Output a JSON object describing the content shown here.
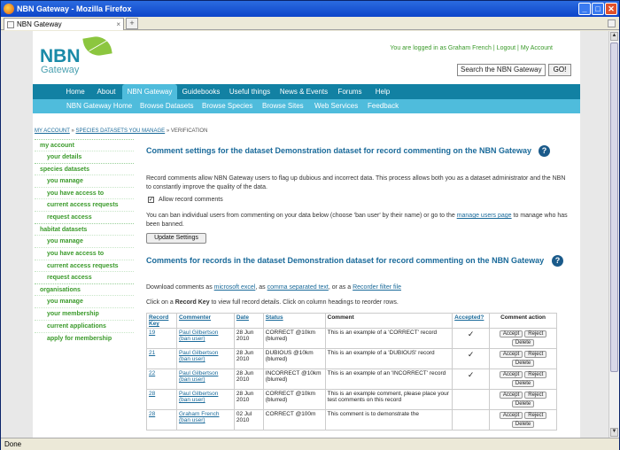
{
  "window": {
    "title": "NBN Gateway - Mozilla Firefox",
    "tab_title": "NBN Gateway",
    "new_tab": "+",
    "status": "Done"
  },
  "header": {
    "logo_main": "NBN",
    "logo_sub": "Gateway",
    "login_text": "You are logged in as Graham French",
    "logout": "Logout",
    "my_account": "My Account",
    "search_value": "Search the NBN Gateway",
    "go": "GO!"
  },
  "nav_primary": [
    "Home",
    "About",
    "NBN Gateway",
    "Guidebooks",
    "Useful things",
    "News & Events",
    "Forums",
    "Help"
  ],
  "nav_secondary": [
    "NBN Gateway Home",
    "Browse Datasets",
    "Browse Species",
    "Browse Sites",
    "Web Services",
    "Feedback"
  ],
  "breadcrumb": {
    "a": "MY ACCOUNT",
    "b": "SPECIES DATASETS YOU MANAGE",
    "c": "VERIFICATION",
    "sep": "»"
  },
  "sidebar": {
    "groups": [
      {
        "head": "my account",
        "items": [
          "your details"
        ]
      },
      {
        "head": "species datasets",
        "items": [
          "you manage",
          "you have access to",
          "current access requests",
          "request access"
        ]
      },
      {
        "head": "habitat datasets",
        "items": [
          "you manage",
          "you have access to",
          "current access requests",
          "request access"
        ]
      },
      {
        "head": "organisations",
        "items": [
          "you manage",
          "your membership",
          "current applications",
          "apply for membership"
        ]
      }
    ]
  },
  "content": {
    "heading1": "Comment settings for the dataset Demonstration dataset for record commenting on the NBN Gateway",
    "intro1": "Record comments allow NBN Gateway users to flag up dubious and incorrect data. This process allows both you as a dataset administrator and the NBN",
    "intro2": "to constantly improve the quality of the data.",
    "allow_label": "Allow record comments",
    "ban1": "You can ban individual users from commenting on your data below (choose 'ban user' by their name) or go to the",
    "ban_link": "manage users page",
    "ban2": "to manage who has",
    "ban3": "been banned.",
    "update_btn": "Update Settings",
    "heading2": "Comments for records in the dataset Demonstration dataset for record commenting on the NBN Gateway",
    "dl1": "Download comments as",
    "dl_excel": "microsoft excel",
    "dl_sep1": ", as",
    "dl_csv": "comma separated text",
    "dl_sep2": ", or as a",
    "dl_filter": "Recorder filter file",
    "click1": "Click on a",
    "click_bold": "Record Key",
    "click2": "to view full record details. Click on column headings to reorder rows.",
    "help": "?"
  },
  "table": {
    "headers": [
      "Record Key",
      "Commenter",
      "Date",
      "Status",
      "Comment",
      "Accepted?",
      "Comment action"
    ],
    "ban_user": "(ban user)",
    "actions": {
      "accept": "Accept",
      "reject": "Reject",
      "delete": "Delete"
    },
    "rows": [
      {
        "key": "19",
        "commenter": "Paul Gilbertson",
        "date": "28 Jun 2010",
        "status": "CORRECT @10km (blurred)",
        "comment": "This is an example of a 'CORRECT' record",
        "accepted": "✓"
      },
      {
        "key": "21",
        "commenter": "Paul Gilbertson",
        "date": "28 Jun 2010",
        "status": "DUBIOUS @10km (blurred)",
        "comment": "This is an example of a 'DUBIOUS' record",
        "accepted": "✓"
      },
      {
        "key": "22",
        "commenter": "Paul Gilbertson",
        "date": "28 Jun 2010",
        "status": "INCORRECT @10km (blurred)",
        "comment": "This is an example of an 'INCORRECT' record",
        "accepted": "✓"
      },
      {
        "key": "28",
        "commenter": "Paul Gilbertson",
        "date": "28 Jun 2010",
        "status": "CORRECT @10km (blurred)",
        "comment": "This is an example comment, please place your test comments on this record",
        "accepted": ""
      },
      {
        "key": "28",
        "commenter": "Graham French",
        "date": "02 Jul 2010",
        "status": "CORRECT @100m",
        "comment": "This comment is to demonstrate the",
        "accepted": ""
      }
    ]
  }
}
